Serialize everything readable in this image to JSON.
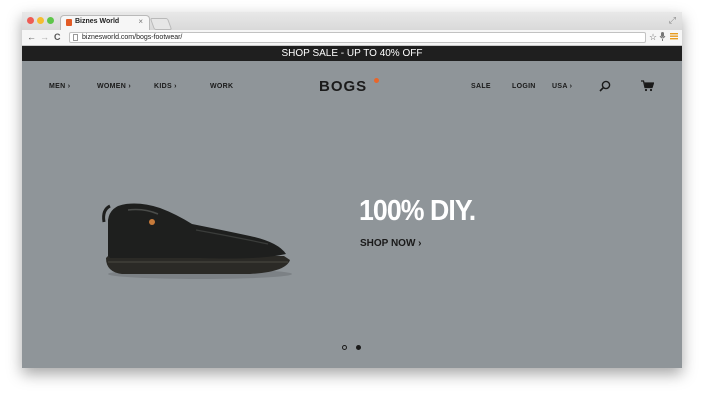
{
  "browser": {
    "tab_title": "Biznes World",
    "tab_close": "×",
    "url": "biznesworld.com/bogs-footwear/",
    "back": "←",
    "forward": "→",
    "reload": "C",
    "resize_icon": "⤢",
    "traffic_colors": [
      "#ee5c54",
      "#f5bd31",
      "#5ec64a"
    ]
  },
  "banner": {
    "text": "SHOP SALE - UP TO 40% OFF"
  },
  "nav": {
    "left": [
      {
        "label": "MEN ›"
      },
      {
        "label": "WOMEN ›"
      },
      {
        "label": "KIDS ›"
      },
      {
        "label": "WORK"
      }
    ],
    "logo": "BOGS",
    "right": [
      {
        "label": "SALE"
      },
      {
        "label": "LOGIN"
      },
      {
        "label": "USA ›"
      }
    ],
    "icons": [
      "search-icon",
      "cart-icon"
    ]
  },
  "hero": {
    "headline": "100% DIY.",
    "cta": "SHOP NOW ›"
  },
  "carousel": {
    "slides": 2,
    "active_index": 1
  },
  "colors": {
    "hero_bg": "#8f9599",
    "banner_bg": "#1f1f1f",
    "logo_accent": "#e8662a"
  }
}
